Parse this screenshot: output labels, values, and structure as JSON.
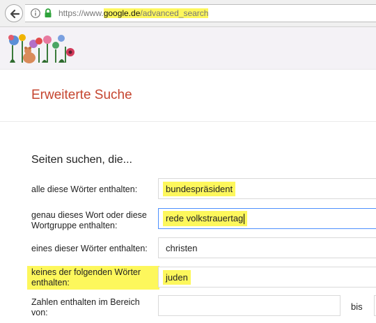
{
  "browser": {
    "url_prefix": "https://www.",
    "url_host": "google.de",
    "url_path": "/advanced_search"
  },
  "page": {
    "title": "Erweiterte Suche",
    "section_title": "Seiten suchen, die..."
  },
  "form": {
    "all_words": {
      "label": "alle diese Wörter enthalten:",
      "value": "bundespräsident"
    },
    "exact_phrase": {
      "label": "genau dieses Wort oder diese Wortgruppe enthalten:",
      "value": "rede volkstrauertag"
    },
    "any_words": {
      "label": "eines dieser Wörter enthalten:",
      "value": "christen"
    },
    "none_words": {
      "label": "keines der folgenden Wörter enthalten:",
      "value": "juden"
    },
    "number_range": {
      "label": "Zahlen enthalten im Bereich von:",
      "from": "",
      "to_label": "bis",
      "to": ""
    }
  },
  "colors": {
    "highlight": "#fdf75c",
    "title": "#c5452f",
    "focus_border": "#4d90fe"
  }
}
